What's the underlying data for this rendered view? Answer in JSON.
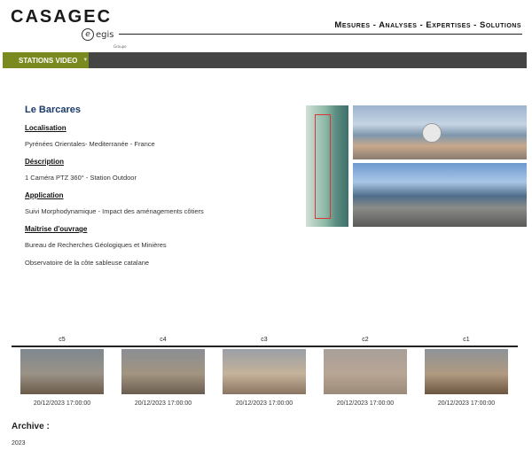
{
  "header": {
    "brand": "CASAGEC",
    "partner": "egis",
    "partner_mark": "e",
    "partner_sub": "Groupe",
    "tagline": "Mesures - Analyses - Expertises - Solutions"
  },
  "nav": {
    "items": [
      {
        "label": "STATIONS VIDEO",
        "caret": "▼"
      }
    ]
  },
  "site": {
    "title": "Le Barcares",
    "sections": [
      {
        "heading": "Localisation",
        "lines": [
          "Pyrénées Orientales- Mediterranée - France"
        ]
      },
      {
        "heading": "Déscription",
        "lines": [
          "1 Caméra PTZ 360° - Station Outdoor"
        ]
      },
      {
        "heading": "Application",
        "lines": [
          "Suivi Morphodynamique - Impact des aménagements côtiers"
        ]
      },
      {
        "heading": "Maitrise d'ouvrage",
        "lines": [
          "Bureau de Recherches Géologiques et Minières",
          "Observatoire de la côte sableuse catalane"
        ]
      }
    ]
  },
  "cameras": [
    {
      "label": "c5",
      "time": "20/12/2023 17:00:00",
      "gradient": [
        "#7f8890",
        "#9a9286",
        "#6b5a48"
      ]
    },
    {
      "label": "c4",
      "time": "20/12/2023 17:00:00",
      "gradient": [
        "#8a8e94",
        "#a29480",
        "#6a5d50"
      ]
    },
    {
      "label": "c3",
      "time": "20/12/2023 17:00:00",
      "gradient": [
        "#9a9fa6",
        "#c5b29a",
        "#8a7562"
      ]
    },
    {
      "label": "c2",
      "time": "20/12/2023 17:00:00",
      "gradient": [
        "#a8a09a",
        "#b8a594",
        "#9c8a7a"
      ]
    },
    {
      "label": "c1",
      "time": "20/12/2023 17:00:00",
      "gradient": [
        "#8e9398",
        "#b09a80",
        "#6b5540"
      ]
    }
  ],
  "archive": {
    "title": "Archive :",
    "years": [
      "2023"
    ]
  }
}
